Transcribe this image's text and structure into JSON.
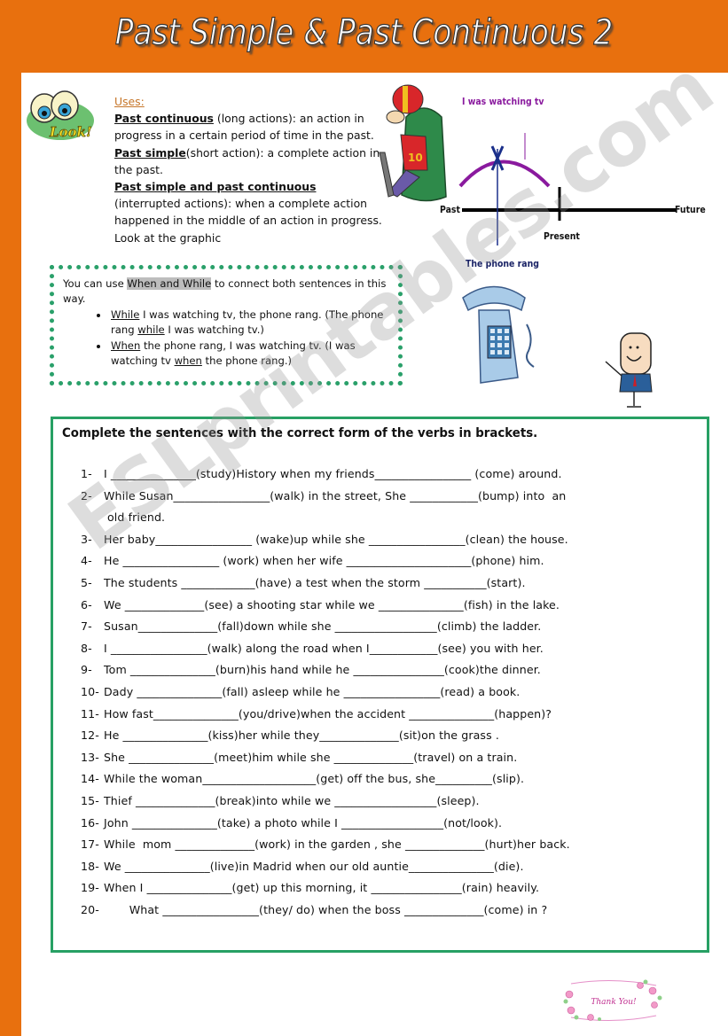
{
  "header": {
    "title": "Past Simple & Past Continuous 2"
  },
  "uses": {
    "label": "Uses:",
    "past_continuous": {
      "term": "Past continuous",
      "text": " (long actions): an action in progress in a certain period of time in the past."
    },
    "past_simple": {
      "term": "Past simple",
      "text": "(short action): a complete action in the past."
    },
    "both": {
      "term": "Past simple and past continuous",
      "text": " (interrupted actions): when a complete action happened in the middle of an action in progress. Look at the graphic"
    }
  },
  "look_badge": {
    "text": "Look!"
  },
  "graph": {
    "top_label": "I was watching tv",
    "past": "Past",
    "present": "Present",
    "future": "Future",
    "bottom_label": "The phone rang",
    "colors": {
      "arc": "#8a1a9e",
      "marker": "#1a2f8a",
      "timeline": "#000000"
    }
  },
  "when_while": {
    "intro_pre": "You can use ",
    "intro_highlight": "When and While",
    "intro_post": " to connect  both sentences in this way.",
    "bullets": [
      {
        "kw": "While",
        "a": " I was watching tv, the phone rang. (The phone rang ",
        "kw2": "while",
        "b": " I was watching tv.)"
      },
      {
        "kw": "When",
        "a": " the phone rang, I was watching tv.    (I was watching tv ",
        "kw2": "when",
        "b": " the phone rang.)"
      }
    ]
  },
  "exercise": {
    "instruction": "Complete the sentences with the correct form of the verbs in brackets.",
    "items": [
      {
        "num": "1-",
        "text": "I _______________(study)History when my friends_________________ (come) around."
      },
      {
        "num": "2-",
        "text": "While Susan_________________(walk) in the street, She ____________(bump) into  an",
        "cont": "old friend."
      },
      {
        "num": "3-",
        "text": "Her baby_________________ (wake)up while she _________________(clean) the house."
      },
      {
        "num": "4-",
        "text": "He _________________ (work) when her wife ______________________(phone) him."
      },
      {
        "num": "5-",
        "text": "The students _____________(have) a test when the storm ___________(start)."
      },
      {
        "num": "6-",
        "text": "We ______________(see) a shooting star while we _______________(fish) in the lake."
      },
      {
        "num": "7-",
        "text": "Susan______________(fall)down while she __________________(climb) the ladder."
      },
      {
        "num": "8-",
        "text": "I _________________(walk) along the road when I____________(see) you with her."
      },
      {
        "num": "9-",
        "text": "Tom _______________(burn)his hand while he ________________(cook)the dinner."
      },
      {
        "num": "10-",
        "text": "Dady _______________(fall) asleep while he _________________(read) a book."
      },
      {
        "num": "11-",
        "text": "How fast_______________(you/drive)when the accident _______________(happen)?"
      },
      {
        "num": "12-",
        "text": "He _______________(kiss)her while they______________(sit)on the grass ."
      },
      {
        "num": "13-",
        "text": "She _______________(meet)him while she ______________(travel) on a train."
      },
      {
        "num": "14-",
        "text": "While the woman____________________(get) off the bus, she__________(slip)."
      },
      {
        "num": "15-",
        "text": "Thief ______________(break)into while we __________________(sleep)."
      },
      {
        "num": "16-",
        "text": "John _______________(take) a photo while I __________________(not/look)."
      },
      {
        "num": "17-",
        "text": "While  mom ______________(work) in the garden , she ______________(hurt)her back."
      },
      {
        "num": "18-",
        "text": "We _______________(live)in Madrid when our old auntie_______________(die)."
      },
      {
        "num": "19-",
        "text": "When I _______________(get) up this morning, it ________________(rain) heavily."
      },
      {
        "num": "20-",
        "text": "       What _________________(they/ do) when the boss ______________(come) in ?"
      }
    ]
  },
  "watermark": "ESLprintables.com",
  "thank_you": "Thank You!",
  "colors": {
    "orange": "#e8700e",
    "green_border": "#27a064",
    "uses_label": "#c6762a"
  }
}
